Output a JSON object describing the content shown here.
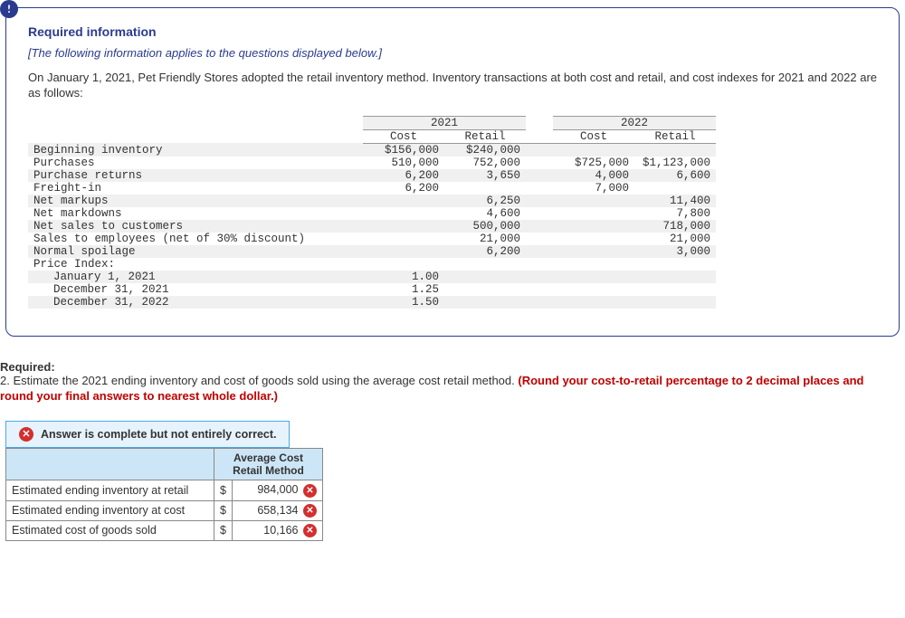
{
  "alert_icon": "!",
  "required": {
    "heading": "Required information",
    "subheading": "[The following information applies to the questions displayed below.]",
    "body": "On January 1, 2021, Pet Friendly Stores adopted the retail inventory method. Inventory transactions at both cost and retail, and cost indexes for 2021 and 2022 are as follows:"
  },
  "table": {
    "year1": "2021",
    "year2": "2022",
    "cost_h": "Cost",
    "retail_h": "Retail",
    "rows": {
      "beg_inv": {
        "label": "Beginning inventory",
        "c1": "$156,000",
        "r1": "$240,000",
        "c2": "",
        "r2": ""
      },
      "purchases": {
        "label": "Purchases",
        "c1": "510,000",
        "r1": "752,000",
        "c2": "$725,000",
        "r2": "$1,123,000"
      },
      "returns": {
        "label": "Purchase returns",
        "c1": "6,200",
        "r1": "3,650",
        "c2": "4,000",
        "r2": "6,600"
      },
      "freight": {
        "label": "Freight-in",
        "c1": "6,200",
        "r1": "",
        "c2": "7,000",
        "r2": ""
      },
      "markups": {
        "label": "Net markups",
        "c1": "",
        "r1": "6,250",
        "c2": "",
        "r2": "11,400"
      },
      "markdowns": {
        "label": "Net markdowns",
        "c1": "",
        "r1": "4,600",
        "c2": "",
        "r2": "7,800"
      },
      "netsales": {
        "label": "Net sales to customers",
        "c1": "",
        "r1": "500,000",
        "c2": "",
        "r2": "718,000"
      },
      "empsales": {
        "label": "Sales to employees (net of 30% discount)",
        "c1": "",
        "r1": "21,000",
        "c2": "",
        "r2": "21,000"
      },
      "spoilage": {
        "label": "Normal spoilage",
        "c1": "",
        "r1": "6,200",
        "c2": "",
        "r2": "3,000"
      },
      "priceidx": {
        "label": "Price Index:",
        "c1": "",
        "r1": "",
        "c2": "",
        "r2": ""
      },
      "jan1": {
        "label": "January 1, 2021",
        "c1": "1.00",
        "r1": "",
        "c2": "",
        "r2": ""
      },
      "dec21": {
        "label": "December 31, 2021",
        "c1": "1.25",
        "r1": "",
        "c2": "",
        "r2": ""
      },
      "dec22": {
        "label": "December 31, 2022",
        "c1": "1.50",
        "r1": "",
        "c2": "",
        "r2": ""
      }
    }
  },
  "q2": {
    "label": "Required:",
    "text_a": "2. Estimate the 2021 ending inventory and cost of goods sold using the average cost retail method. ",
    "text_b": "(Round your cost-to-retail percentage to 2 decimal places and round your final answers to nearest whole dollar.)"
  },
  "banner": {
    "icon": "✕",
    "text": "Answer is complete but not entirely correct."
  },
  "answer": {
    "header": "Average Cost Retail Method",
    "currency": "$",
    "rows": {
      "r1": {
        "label": "Estimated ending inventory at retail",
        "val": "984,000"
      },
      "r2": {
        "label": "Estimated ending inventory at cost",
        "val": "658,134"
      },
      "r3": {
        "label": "Estimated cost of goods sold",
        "val": "10,166"
      }
    },
    "x": "✕"
  }
}
